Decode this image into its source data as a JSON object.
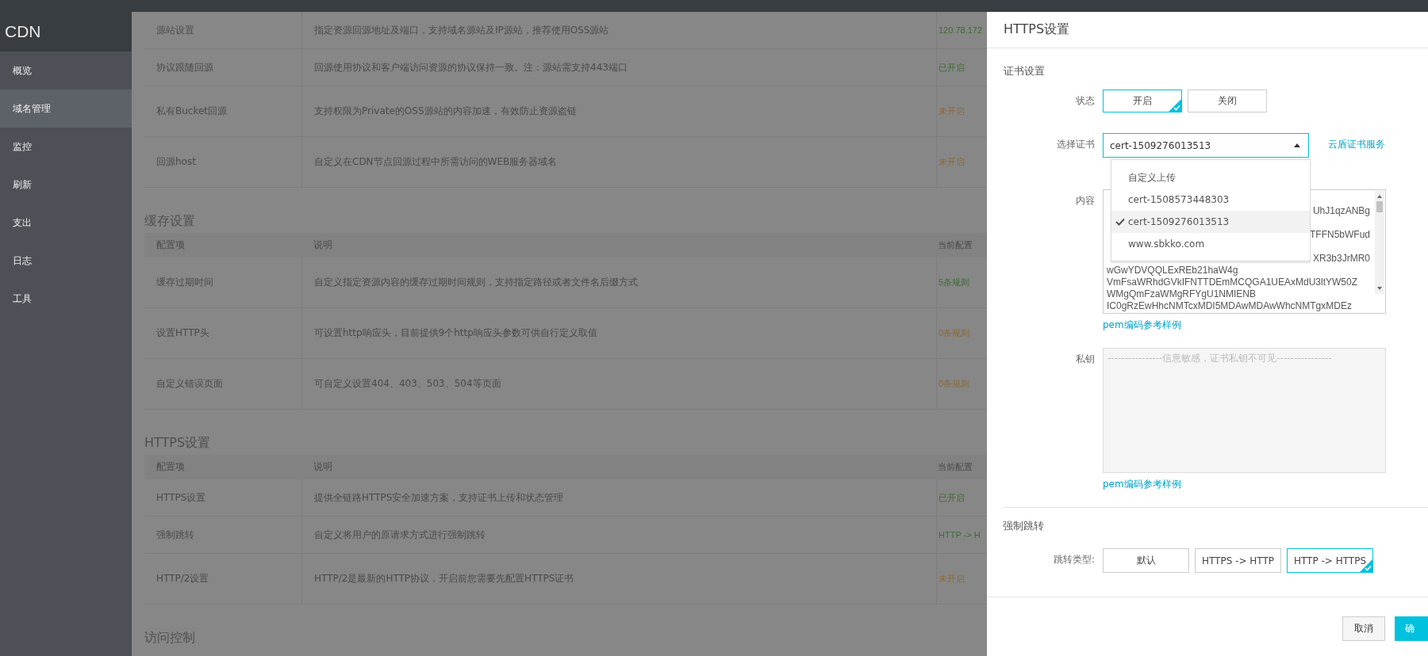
{
  "sidebar": {
    "title": "CDN",
    "items": [
      {
        "label": "概览",
        "selected": false
      },
      {
        "label": "域名管理",
        "selected": true
      },
      {
        "label": "监控",
        "selected": false
      },
      {
        "label": "刷新",
        "selected": false
      },
      {
        "label": "支出",
        "selected": false
      },
      {
        "label": "日志",
        "selected": false
      },
      {
        "label": "工具",
        "selected": false
      }
    ]
  },
  "sections": [
    {
      "rows": [
        {
          "name": "源站设置",
          "description": "指定资源回源地址及端口，支持域名源站及IP源站，推荐使用OSS源站",
          "value": "120.78.172",
          "color": "#3f6b32"
        },
        {
          "name": "协议跟随回源",
          "description": "回源使用协议和客户端访问资源的协议保持一致。注：源站需支持443端口",
          "value": "已开启",
          "color": "#3f6b32"
        },
        {
          "name": "私有Bucket回源",
          "description": "支持权限为Private的OSS源站的内容加速，有效防止资源盗链",
          "value": "未开启",
          "color": "#8a6a3a"
        },
        {
          "name": "回源host",
          "description": "自定义在CDN节点回源过程中所需访问的WEB服务器域名",
          "value": "未开启",
          "color": "#8a6a3a"
        }
      ]
    },
    {
      "title": "缓存设置",
      "columns": [
        "配置项",
        "说明",
        "当前配置"
      ],
      "rows": [
        {
          "name": "缓存过期时间",
          "description": "自定义指定资源内容的缓存过期时间规则，支持指定路径或者文件名后缀方式",
          "value": "5条规则",
          "color": "#3f6b32"
        },
        {
          "name": "设置HTTP头",
          "description": "可设置http响应头，目前提供9个http响应头参数可供自行定义取值",
          "value": "0条规则",
          "color": "#8a6a3a"
        },
        {
          "name": "自定义错误页面",
          "description": "可自定义设置404、403、503、504等页面",
          "value": "0条规则",
          "color": "#8a6a3a"
        }
      ]
    },
    {
      "title": "HTTPS设置",
      "columns": [
        "配置项",
        "说明",
        "当前配置"
      ],
      "rows": [
        {
          "name": "HTTPS设置",
          "description": "提供全链路HTTPS安全加速方案，支持证书上传和状态管理",
          "value": "已开启",
          "color": "#3f6b32"
        },
        {
          "name": "强制跳转",
          "description": "自定义将用户的原请求方式进行强制跳转",
          "value": "HTTP -> H",
          "color": "#3f6b32"
        },
        {
          "name": "HTTP/2设置",
          "description": "HTTP/2是最新的HTTP协议，开启前您需要先配置HTTPS证书",
          "value": "未开启",
          "color": "#8a6a3a"
        }
      ]
    },
    {
      "title": "访问控制"
    }
  ],
  "drawer": {
    "title": "HTTPS设置",
    "cert_section": {
      "title": "证书设置",
      "status": {
        "label": "状态",
        "options": [
          {
            "label": "开启",
            "selected": true
          },
          {
            "label": "关闭",
            "selected": false
          }
        ]
      },
      "cert_select": {
        "label": "选择证书",
        "value": "cert-1509276013513",
        "expanded": true,
        "link": "云盾证书服务",
        "options": [
          {
            "label": "自定义上传",
            "selected": false
          },
          {
            "label": "cert-1508573448303",
            "selected": false
          },
          {
            "label": "cert-1509276013513",
            "selected": true
          },
          {
            "label": "www.sbkko.com",
            "selected": false
          }
        ]
      },
      "content": {
        "label": "内容",
        "link": "pem编码参考样例",
        "lines": [
          {
            "kind": "tail",
            "text": "UhJ1qzANBg"
          },
          {
            "kind": "tail",
            "text": "TFFN5bWFud"
          },
          {
            "kind": "tail",
            "text": "XR3b3JrMR0"
          },
          {
            "kind": "line",
            "text": "wGwYDVQQLExREb21haW4g"
          },
          {
            "kind": "line",
            "text": "VmFsaWRhdGVkIFNTTDEmMCQGA1UEAxMdU3ltYW50Z"
          },
          {
            "kind": "line",
            "text": "WMgQmFzaWMgRFYgU1NMIENB"
          },
          {
            "kind": "line",
            "text": "IC0gRzEwHhcNMTcxMDI5MDAwMDAwWhcNMTgxMDEz"
          }
        ]
      },
      "private_key": {
        "label": "私钥",
        "placeholder": "----------------信息敏感，证书私钥不可见----------------",
        "link": "pem编码参考样例"
      }
    },
    "redirect_section": {
      "title": "强制跳转",
      "label": "跳转类型:",
      "options": [
        {
          "label": "默认",
          "selected": false
        },
        {
          "label": "HTTPS -> HTTP",
          "selected": false
        },
        {
          "label": "HTTP -> HTTPS",
          "selected": true
        }
      ]
    },
    "buttons": [
      {
        "label": "取消",
        "kind": "secondary"
      },
      {
        "label": "确",
        "kind": "primary"
      }
    ]
  }
}
